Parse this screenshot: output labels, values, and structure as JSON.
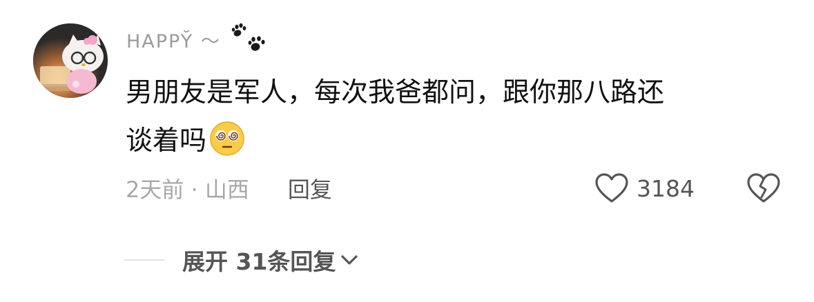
{
  "comment": {
    "username": "HAPPY̆ ～",
    "avatar_icon": "hello-kitty-avatar",
    "badge_icon": "paw-prints-icon",
    "text_line1": "男朋友是军人，每次我爸都问，跟你那八路还",
    "text_line2": "谈着吗",
    "emoji_icon": "dizzy-face-emoji",
    "time_location": "2天前 · 山西",
    "reply_label": "回复",
    "like_icon": "heart-outline-icon",
    "like_count": "3184",
    "dislike_icon": "broken-heart-icon",
    "expand_label": "展开 31条回复",
    "expand_icon": "chevron-down-icon"
  },
  "colors": {
    "username": "#9b9b9b",
    "text": "#111111",
    "meta": "#a8a8a8",
    "action": "#555555",
    "divider": "#e3e3e3"
  }
}
